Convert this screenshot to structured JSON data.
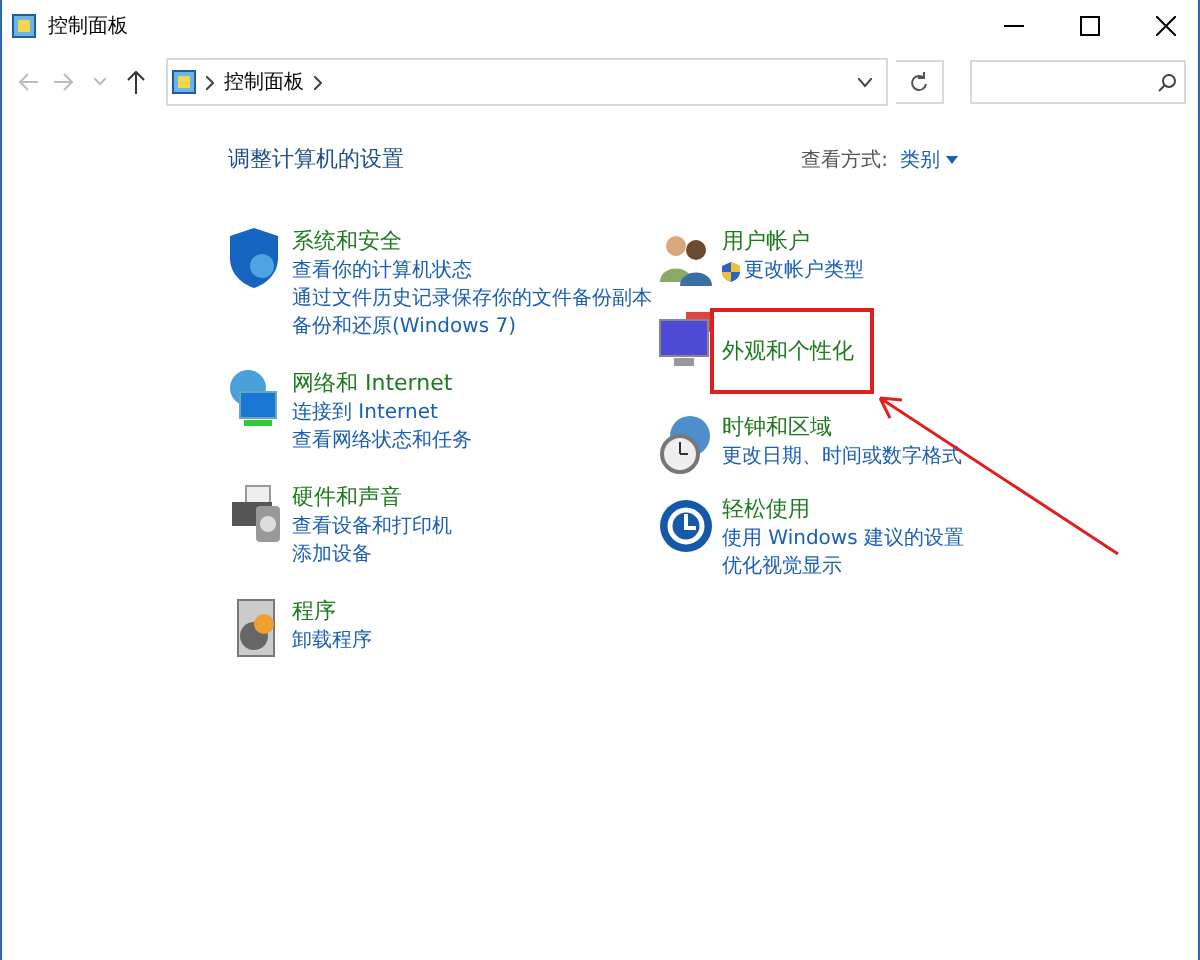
{
  "window": {
    "title": "控制面板"
  },
  "address_bar": {
    "path": [
      "控制面板"
    ]
  },
  "heading": "调整计算机的设置",
  "view_by": {
    "label": "查看方式:",
    "value": "类别"
  },
  "columns": [
    {
      "categories": [
        {
          "title": "系统和安全",
          "highlighted": false,
          "links": [
            {
              "text": "查看你的计算机状态",
              "shield": false
            },
            {
              "text": "通过文件历史记录保存你的文件备份副本",
              "shield": false
            },
            {
              "text": "备份和还原(Windows 7)",
              "shield": false
            }
          ]
        },
        {
          "title": "网络和 Internet",
          "highlighted": false,
          "links": [
            {
              "text": "连接到 Internet",
              "shield": false
            },
            {
              "text": "查看网络状态和任务",
              "shield": false
            }
          ]
        },
        {
          "title": "硬件和声音",
          "highlighted": false,
          "links": [
            {
              "text": "查看设备和打印机",
              "shield": false
            },
            {
              "text": "添加设备",
              "shield": false
            }
          ]
        },
        {
          "title": "程序",
          "highlighted": false,
          "links": [
            {
              "text": "卸载程序",
              "shield": false
            }
          ]
        }
      ]
    },
    {
      "categories": [
        {
          "title": "用户帐户",
          "highlighted": false,
          "links": [
            {
              "text": "更改帐户类型",
              "shield": true
            }
          ]
        },
        {
          "title": "外观和个性化",
          "highlighted": true
        },
        {
          "title": "时钟和区域",
          "highlighted": false,
          "links": [
            {
              "text": "更改日期、时间或数字格式",
              "shield": false
            }
          ]
        },
        {
          "title": "轻松使用",
          "highlighted": false,
          "links": [
            {
              "text": "使用 Windows 建议的设置",
              "shield": false
            },
            {
              "text": "优化视觉显示",
              "shield": false
            }
          ]
        }
      ]
    }
  ]
}
